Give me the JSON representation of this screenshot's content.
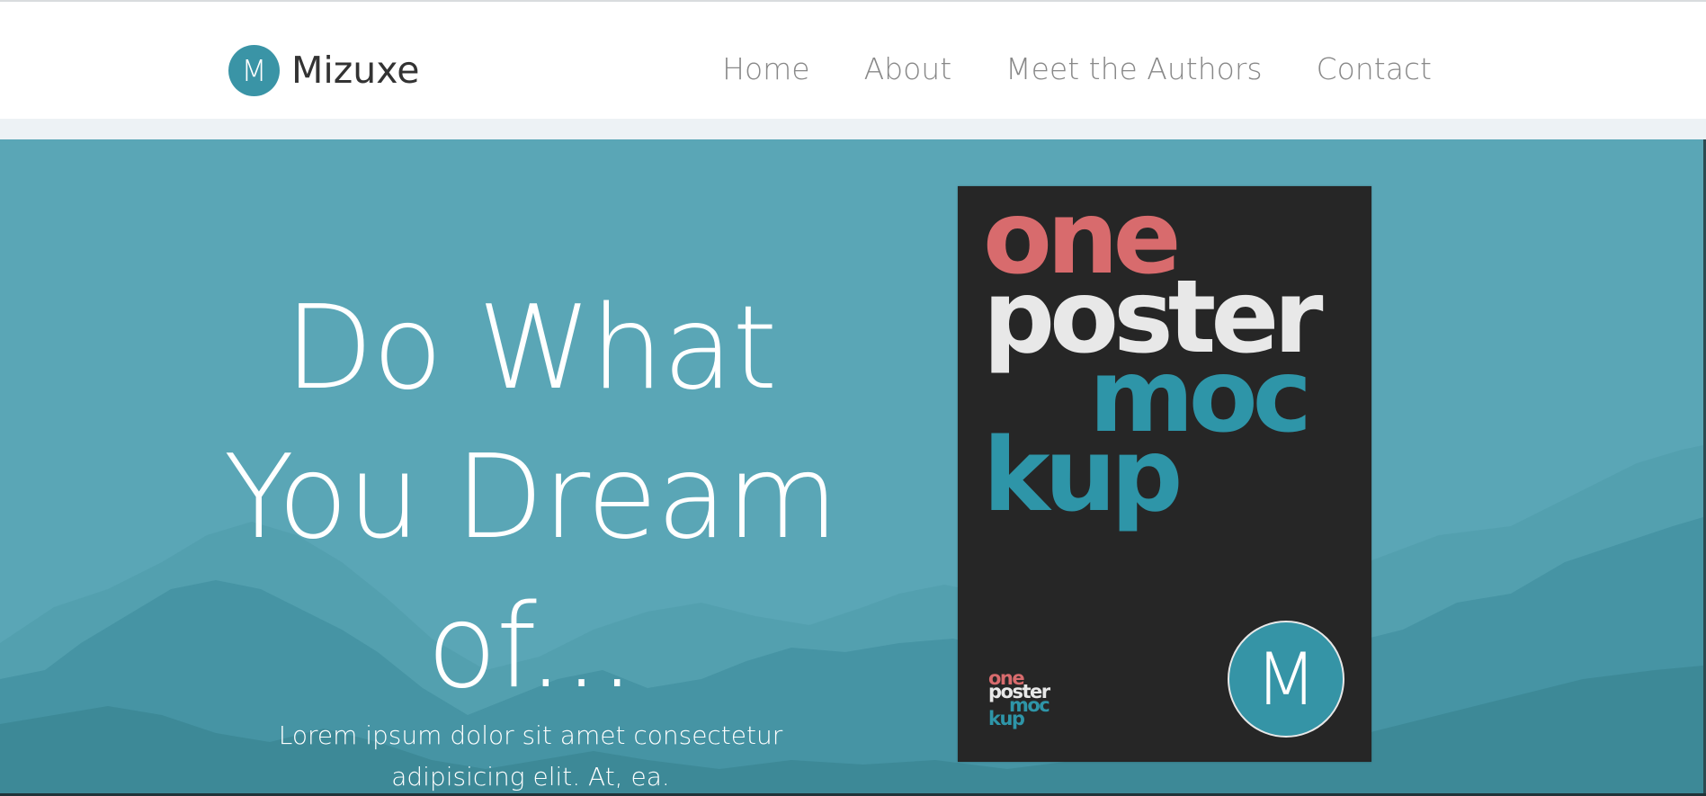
{
  "brand": {
    "logo_letter": "M",
    "name": "Mizuxe"
  },
  "nav": {
    "items": [
      "Home",
      "About",
      "Meet the Authors",
      "Contact"
    ]
  },
  "hero": {
    "headline_lines": [
      "Do What",
      "You Dream",
      "of..."
    ],
    "subtext": "Lorem ipsum dolor sit amet consectetur adipisicing elit. At, ea."
  },
  "poster": {
    "words": [
      "one",
      "poster",
      "moc",
      "kup"
    ],
    "badge_letter": "M"
  },
  "colors": {
    "accent": "#3a94a6",
    "hero_bg": "#5aa6b6",
    "poster_bg": "#262626",
    "poster_red": "#d86b6d",
    "poster_teal": "#2e95a8"
  }
}
